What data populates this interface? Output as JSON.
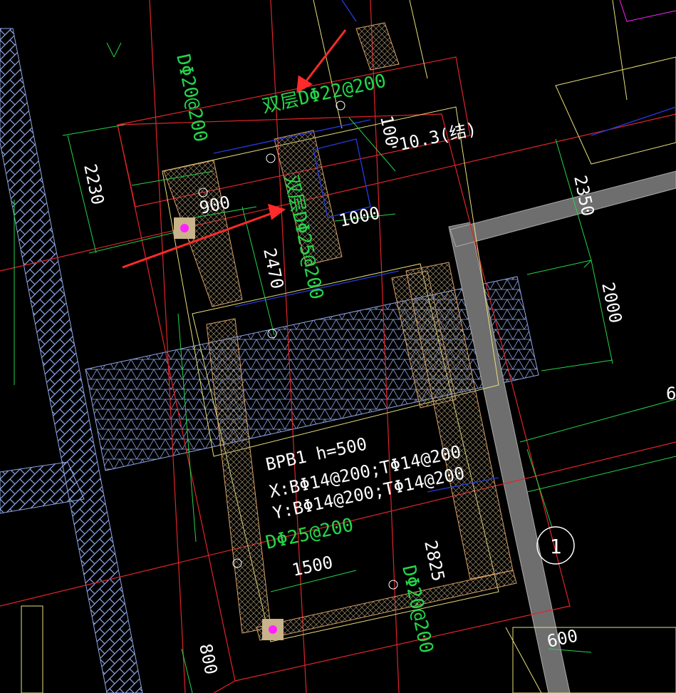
{
  "drawing": {
    "background": "#000000",
    "colors": {
      "red": "#e0242b",
      "green": "#22d64a",
      "white": "#ffffff",
      "yellow": "#e8e07a",
      "blue": "#2438d6",
      "hatch_blue": "#8ea6e6",
      "magenta": "#ff22ff",
      "grey": "#8a8a8a",
      "arrow_red": "#ff2a2a",
      "orange": "#d9a066"
    }
  },
  "annotations": {
    "top_rebar": "双层DΦ22@200",
    "mid_rebar": "双层DΦ25@200",
    "left_rebar": "DΦ20@200",
    "right_rebar": "DΦ20@200",
    "bottom_rebar": "DΦ25@200",
    "elevation": "-10.3(结)",
    "slab_name": "BPB1 h=500",
    "slab_x": "X:BΦ14@200;TΦ14@200",
    "slab_y": "Y:BΦ14@200;TΦ14@200",
    "axis_number": "1"
  },
  "dimensions": {
    "d2230": "2230",
    "d900": "900",
    "d1000": "1000",
    "d2470": "2470",
    "d2350": "2350",
    "d2000": "2000",
    "d1500": "1500",
    "d2825": "2825",
    "d800": "800",
    "d600": "600",
    "d100": "100",
    "d6_partial": "6"
  }
}
